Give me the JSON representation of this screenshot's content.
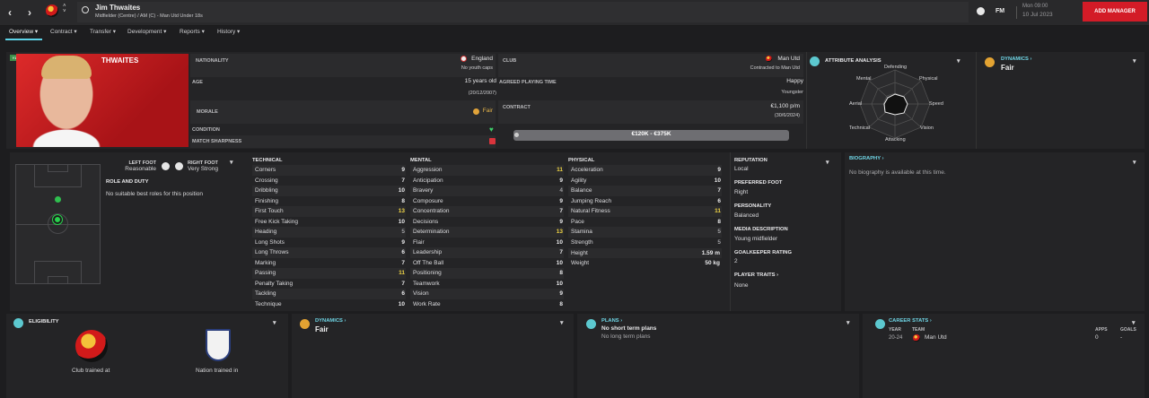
{
  "header": {
    "player_name": "Jim Thwaites",
    "player_subtitle": "Midfielder (Centre) / AM (C) - Man Utd Under 18s",
    "fm_label": "FM",
    "date_day": "Mon 09:00",
    "date": "10 Jul 2023",
    "add_manager": "ADD MANAGER"
  },
  "tabs": [
    "Overview",
    "Contract",
    "Transfer",
    "Development",
    "Reports",
    "History"
  ],
  "profile": {
    "squad_tag": "Y18",
    "surname": "THWAITES",
    "nationality_label": "NATIONALITY",
    "nationality": "England",
    "youth_caps": "No youth caps",
    "age_label": "AGE",
    "age": "15 years old",
    "dob": "(20/12/2007)",
    "morale_label": "MORALE",
    "morale": "Fair",
    "condition_label": "CONDITION",
    "sharpness_label": "MATCH SHARPNESS",
    "club_label": "CLUB",
    "club": "Man Utd",
    "contracted": "Contracted to Man Utd",
    "apt_label": "AGREED PLAYING TIME",
    "apt": "Happy",
    "apt_sub": "Youngster",
    "contract_label": "CONTRACT",
    "wage": "€1,100 p/m",
    "contract_end": "(30/6/2024)",
    "value_range": "€120K - €375K"
  },
  "attribute_analysis": {
    "title": "ATTRIBUTE ANALYSIS",
    "axes": [
      "Defending",
      "Physical",
      "Speed",
      "Vision",
      "Attacking",
      "Technical",
      "Aerial",
      "Mental"
    ]
  },
  "dynamics_top": {
    "title": "DYNAMICS",
    "value": "Fair"
  },
  "pitch": {
    "left_foot_label": "LEFT FOOT",
    "left_foot": "Reasonable",
    "right_foot_label": "RIGHT FOOT",
    "right_foot": "Very Strong",
    "role_title": "ROLE AND DUTY",
    "role_text": "No suitable best roles for this position"
  },
  "technical": {
    "title": "TECHNICAL",
    "items": [
      [
        "Corners",
        "9"
      ],
      [
        "Crossing",
        "7"
      ],
      [
        "Dribbling",
        "10"
      ],
      [
        "Finishing",
        "8"
      ],
      [
        "First Touch",
        "13"
      ],
      [
        "Free Kick Taking",
        "10"
      ],
      [
        "Heading",
        "5"
      ],
      [
        "Long Shots",
        "9"
      ],
      [
        "Long Throws",
        "6"
      ],
      [
        "Marking",
        "7"
      ],
      [
        "Passing",
        "11"
      ],
      [
        "Penalty Taking",
        "7"
      ],
      [
        "Tackling",
        "6"
      ],
      [
        "Technique",
        "10"
      ]
    ]
  },
  "mental": {
    "title": "MENTAL",
    "items": [
      [
        "Aggression",
        "11"
      ],
      [
        "Anticipation",
        "9"
      ],
      [
        "Bravery",
        "4"
      ],
      [
        "Composure",
        "9"
      ],
      [
        "Concentration",
        "7"
      ],
      [
        "Decisions",
        "9"
      ],
      [
        "Determination",
        "13"
      ],
      [
        "Flair",
        "10"
      ],
      [
        "Leadership",
        "7"
      ],
      [
        "Off The Ball",
        "10"
      ],
      [
        "Positioning",
        "8"
      ],
      [
        "Teamwork",
        "10"
      ],
      [
        "Vision",
        "9"
      ],
      [
        "Work Rate",
        "8"
      ]
    ]
  },
  "physical": {
    "title": "PHYSICAL",
    "items": [
      [
        "Acceleration",
        "9"
      ],
      [
        "Agility",
        "10"
      ],
      [
        "Balance",
        "7"
      ],
      [
        "Jumping Reach",
        "6"
      ],
      [
        "Natural Fitness",
        "11"
      ],
      [
        "Pace",
        "8"
      ],
      [
        "Stamina",
        "5"
      ],
      [
        "Strength",
        "5"
      ]
    ],
    "height_label": "Height",
    "height": "1.59 m",
    "weight_label": "Weight",
    "weight": "50 kg"
  },
  "info": {
    "reputation_label": "REPUTATION",
    "reputation": "Local",
    "foot_label": "PREFERRED FOOT",
    "foot": "Right",
    "personality_label": "PERSONALITY",
    "personality": "Balanced",
    "media_label": "MEDIA DESCRIPTION",
    "media": "Young midfielder",
    "gk_label": "GOALKEEPER RATING",
    "gk": "2",
    "traits_label": "PLAYER TRAITS",
    "traits": "None"
  },
  "biography": {
    "title": "BIOGRAPHY",
    "text": "No biography is available at this time."
  },
  "eligibility": {
    "title": "ELIGIBILITY",
    "club_caption": "Club trained at",
    "nation_caption": "Nation trained in"
  },
  "dynamics_bottom": {
    "title": "DYNAMICS",
    "value": "Fair"
  },
  "plans": {
    "title": "PLANS",
    "short": "No short term plans",
    "long": "No long term plans"
  },
  "career": {
    "title": "CAREER STATS",
    "col_year": "YEAR",
    "col_team": "TEAM",
    "col_apps": "APPS",
    "col_goals": "GOALS",
    "year": "20-24",
    "team": "Man Utd",
    "apps": "0",
    "goals": "-"
  },
  "colors": {
    "accent": "#5cd1e6",
    "highlight": "#f0d545",
    "add_manager": "#d31b27"
  }
}
